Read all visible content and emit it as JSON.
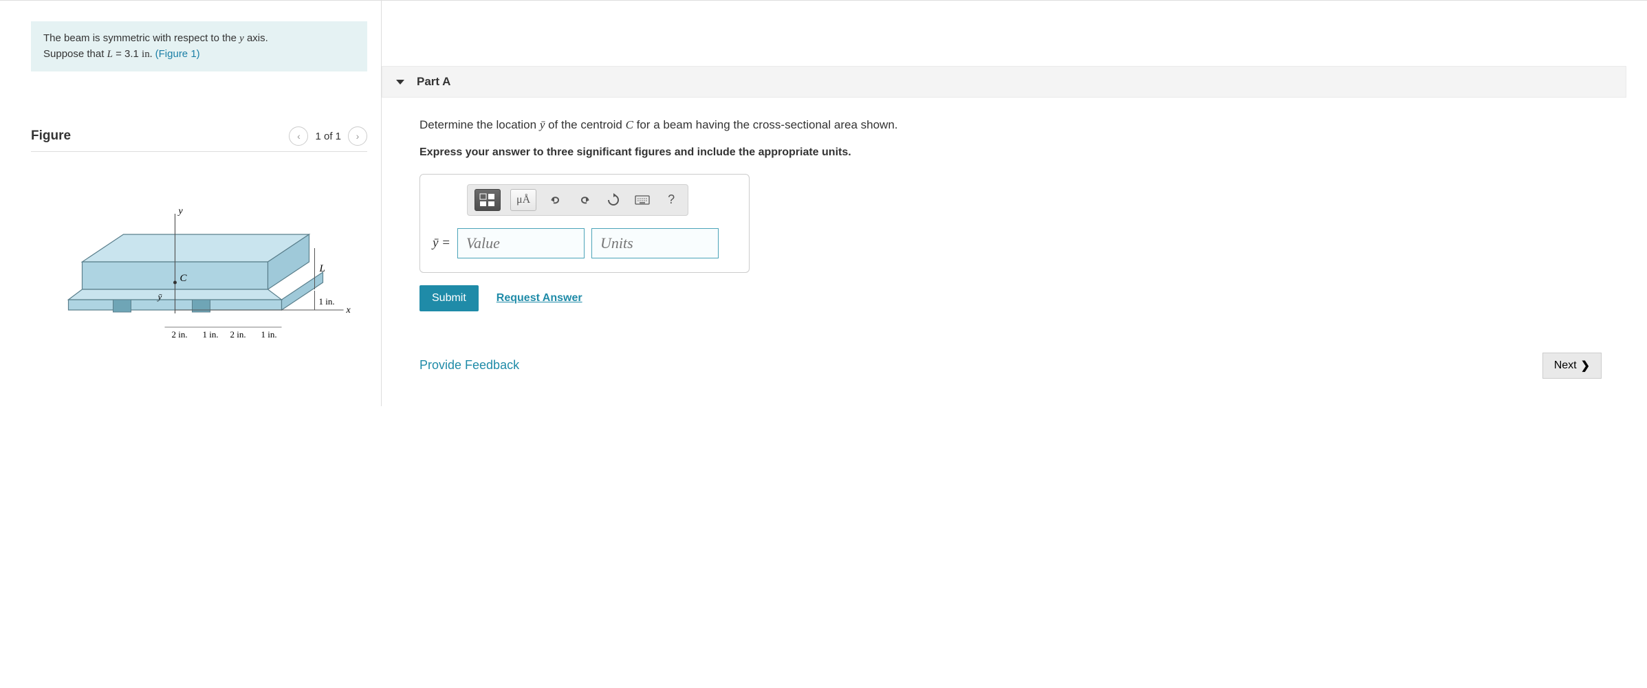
{
  "intro": {
    "line1_pre": "The beam is symmetric with respect to the ",
    "line1_var": "y",
    "line1_post": " axis.",
    "line2_pre": "Suppose that ",
    "line2_varL": "L",
    "line2_eq": " = 3.1 ",
    "line2_unit": "in.",
    "fig_link": "(Figure 1)"
  },
  "figure": {
    "title": "Figure",
    "counter": "1 of 1",
    "dim_L": "L",
    "dim_1in": "1 in.",
    "dim_2in": "2 in.",
    "dim_1in_b": "1 in.",
    "dim_2in_b": "2 in.",
    "dim_1in_c": "1 in.",
    "axis_x": "x",
    "axis_y": "y",
    "label_ybar": "ȳ",
    "label_C": "C"
  },
  "part": {
    "header": "Part A",
    "question_pre": "Determine the location ",
    "question_var1": "ȳ",
    "question_mid": " of the centroid ",
    "question_var2": "C",
    "question_post": " for a beam having the cross-sectional area shown.",
    "instruction": "Express your answer to three significant figures and include the appropriate units.",
    "eq_label": "ȳ =",
    "value_ph": "Value",
    "units_ph": "Units",
    "toolbar": {
      "units_btn": "μÅ",
      "help": "?"
    },
    "submit": "Submit",
    "request": "Request Answer"
  },
  "footer": {
    "feedback": "Provide Feedback",
    "next": "Next"
  }
}
